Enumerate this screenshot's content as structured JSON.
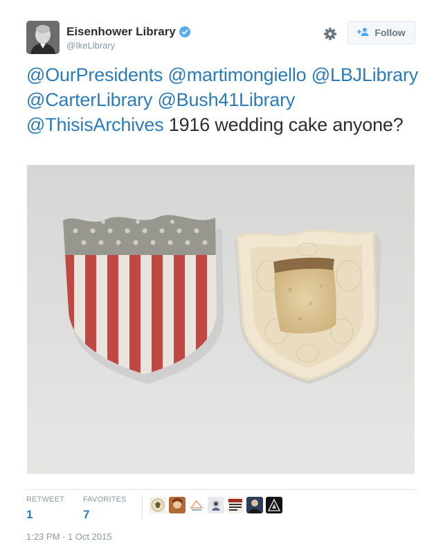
{
  "account": {
    "display_name": "Eisenhower Library",
    "handle": "@IkeLibrary",
    "verified": true
  },
  "actions": {
    "follow_label": "Follow"
  },
  "tweet": {
    "mentions": [
      "@OurPresidents",
      "@martimongiello",
      "@LBJLibrary",
      "@CarterLibrary",
      "@Bush41Library",
      "@ThisisArchives"
    ],
    "text": "1916 wedding cake anyone?"
  },
  "stats": {
    "retweet_label": "RETWEET",
    "retweet_count": "1",
    "favorites_label": "FAVORITES",
    "favorites_count": "7"
  },
  "favoriters_count_shown": 7,
  "timestamp": "1:23 PM - 1 Oct 2015",
  "colors": {
    "link": "#2b7bb9",
    "text": "#292f33",
    "muted": "#8899a6",
    "verified": "#55acee"
  },
  "icons": [
    "verified-badge-icon",
    "gear-icon",
    "follow-user-icon"
  ]
}
